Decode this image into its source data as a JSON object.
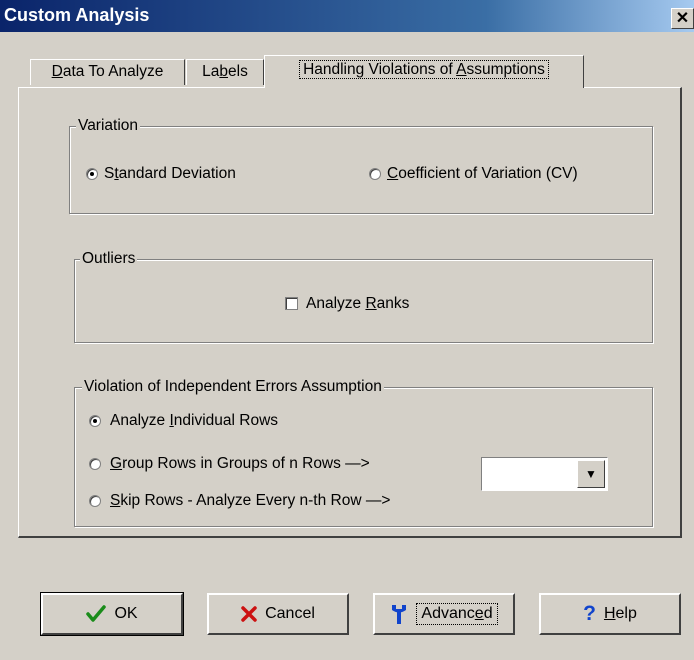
{
  "window": {
    "title": "Custom Analysis",
    "close_glyph": "✕"
  },
  "tabs": [
    {
      "pre": "",
      "u": "D",
      "post": "ata To Analyze"
    },
    {
      "pre": "La",
      "u": "b",
      "post": "els"
    },
    {
      "pre": "Handling Violations of ",
      "u": "A",
      "post": "ssumptions"
    }
  ],
  "variation": {
    "legend": "Variation",
    "std": {
      "pre": "S",
      "u": "t",
      "post": "andard Deviation"
    },
    "cv": {
      "pre": "",
      "u": "C",
      "post": "oefficient of Variation (CV)"
    }
  },
  "outliers": {
    "legend": "Outliers",
    "ranks": {
      "pre": "Analyze ",
      "u": "R",
      "post": "anks"
    }
  },
  "independent": {
    "legend": "Violation of Independent Errors Assumption",
    "rows": {
      "pre": "Analyze ",
      "u": "I",
      "post": "ndividual Rows"
    },
    "group": {
      "pre": "",
      "u": "G",
      "post": "roup Rows in Groups of n Rows —>"
    },
    "skip": {
      "pre": "",
      "u": "S",
      "post": "kip Rows - Analyze Every n-th Row —>"
    },
    "combo_value": ""
  },
  "buttons": {
    "ok": {
      "label": "OK",
      "icon": "checkmark-icon",
      "color": "#1a8c1a"
    },
    "cancel": {
      "label": "Cancel",
      "icon": "x-icon",
      "color": "#cc1111"
    },
    "advanced": {
      "pre": "Advanc",
      "u": "e",
      "post": "d",
      "icon": "wrench-icon",
      "color": "#1144cc"
    },
    "help": {
      "pre": "",
      "u": "H",
      "post": "elp",
      "icon": "question-icon",
      "color": "#1144cc"
    }
  }
}
